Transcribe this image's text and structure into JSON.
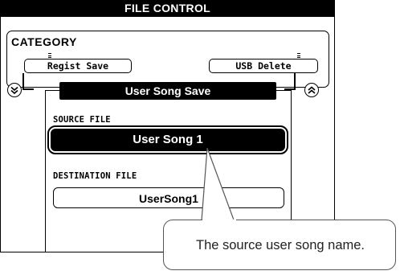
{
  "title": "FILE CONTROL",
  "category": {
    "label": "CATEGORY",
    "left_item": "Regist Save",
    "right_item": "USB Delete"
  },
  "function_title": "User Song Save",
  "source": {
    "label": "SOURCE FILE",
    "value": "User Song 1"
  },
  "destination": {
    "label": "DESTINATION FILE",
    "value": "UserSong1"
  },
  "callout": "The source user song name."
}
